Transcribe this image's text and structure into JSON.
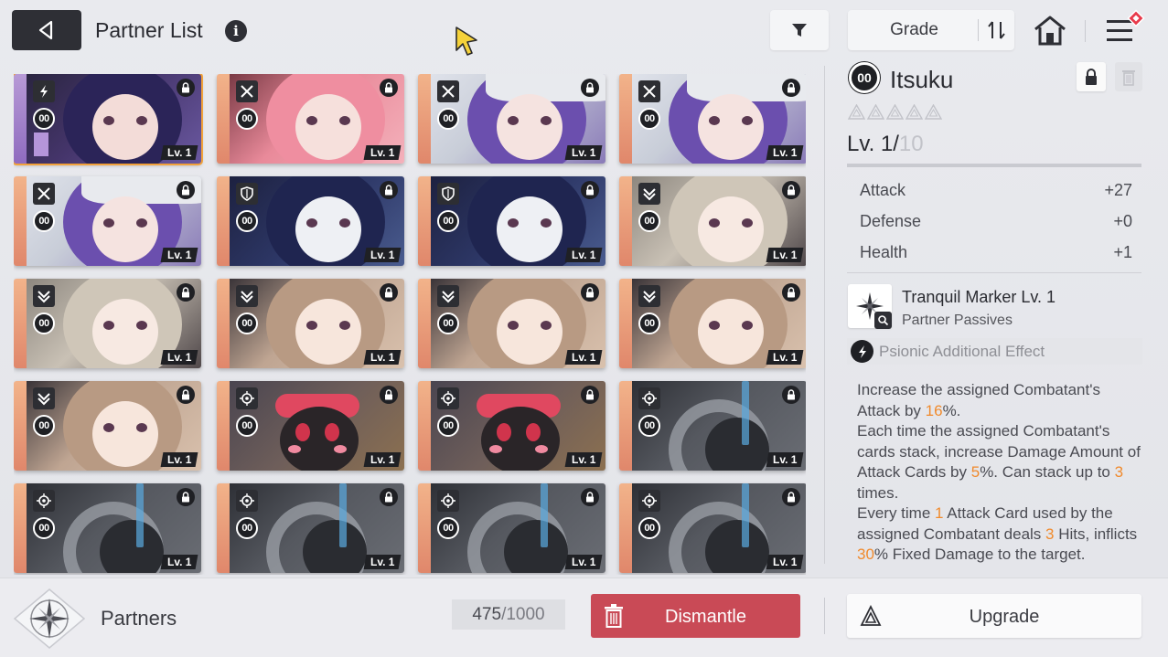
{
  "header": {
    "title": "Partner List",
    "info_icon": "i",
    "sort_label": "Grade",
    "icons": [
      "back-arrow-icon",
      "info-icon",
      "filter-icon",
      "sort-icon",
      "home-icon",
      "menu-icon",
      "notification-diamond-icon"
    ]
  },
  "grid": {
    "cards": [
      {
        "count": "00",
        "level": "Lv. 1",
        "type_icon": "lightning-icon",
        "art": "purple-hair",
        "selected": true
      },
      {
        "count": "00",
        "level": "Lv. 1",
        "type_icon": "crossed-swords-icon",
        "art": "pink-hair"
      },
      {
        "count": "00",
        "level": "Lv. 1",
        "type_icon": "crossed-swords-icon",
        "art": "violet-hat"
      },
      {
        "count": "00",
        "level": "Lv. 1",
        "type_icon": "crossed-swords-icon",
        "art": "violet-hat"
      },
      {
        "count": "00",
        "level": "Lv. 1",
        "type_icon": "crossed-swords-icon",
        "art": "violet-hat"
      },
      {
        "count": "00",
        "level": "Lv. 1",
        "type_icon": "shield-icon",
        "art": "navy-hair"
      },
      {
        "count": "00",
        "level": "Lv. 1",
        "type_icon": "shield-icon",
        "art": "navy-hair"
      },
      {
        "count": "00",
        "level": "Lv. 1",
        "type_icon": "chevron-swords-icon",
        "art": "silver-hair"
      },
      {
        "count": "00",
        "level": "Lv. 1",
        "type_icon": "chevron-swords-icon",
        "art": "silver-hair"
      },
      {
        "count": "00",
        "level": "Lv. 1",
        "type_icon": "chevron-swords-icon",
        "art": "tan-hair"
      },
      {
        "count": "00",
        "level": "Lv. 1",
        "type_icon": "chevron-swords-icon",
        "art": "tan-hair"
      },
      {
        "count": "00",
        "level": "Lv. 1",
        "type_icon": "chevron-swords-icon",
        "art": "tan-hair"
      },
      {
        "count": "00",
        "level": "Lv. 1",
        "type_icon": "chevron-swords-icon",
        "art": "tan-hair"
      },
      {
        "count": "00",
        "level": "Lv. 1",
        "type_icon": "target-icon",
        "art": "creature"
      },
      {
        "count": "00",
        "level": "Lv. 1",
        "type_icon": "target-icon",
        "art": "creature"
      },
      {
        "count": "00",
        "level": "Lv. 1",
        "type_icon": "target-icon",
        "art": "mech"
      },
      {
        "count": "00",
        "level": "Lv. 1",
        "type_icon": "target-icon",
        "art": "mech"
      },
      {
        "count": "00",
        "level": "Lv. 1",
        "type_icon": "target-icon",
        "art": "mech"
      },
      {
        "count": "00",
        "level": "Lv. 1",
        "type_icon": "target-icon",
        "art": "mech"
      },
      {
        "count": "00",
        "level": "Lv. 1",
        "type_icon": "target-icon",
        "art": "mech"
      }
    ]
  },
  "detail": {
    "badge": "00",
    "name": "Itsuku",
    "stars_total": 5,
    "stars_filled": 0,
    "level_current": "Lv. 1/",
    "level_max": "10",
    "stats": [
      {
        "label": "Attack",
        "value": "+27"
      },
      {
        "label": "Defense",
        "value": "+0"
      },
      {
        "label": "Health",
        "value": "+1"
      }
    ],
    "skill": {
      "name": "Tranquil Marker Lv. 1",
      "subtitle": "Partner Passives",
      "icon": "sparkle-star-icon"
    },
    "effect_label": "Psionic Additional Effect",
    "description": {
      "p1a": "Increase the assigned Combatant's Attack by ",
      "p1v": "16",
      "p1b": "%.",
      "p2a": "Each time the assigned Combatant's cards stack, increase Damage Amount of Attack Cards by ",
      "p2v": "5",
      "p2b": "%. Can stack up to ",
      "p2v2": "3",
      "p2c": " times.",
      "p3a": "Every time ",
      "p3v": "1",
      "p3b": " Attack Card used by the assigned Combatant deals ",
      "p3v2": "3",
      "p3c": " Hits, inflicts ",
      "p3v3": "30",
      "p3d": "% Fixed Damage to the target."
    }
  },
  "footer": {
    "partners_label": "Partners",
    "capacity_current": "475",
    "capacity_sep": " / ",
    "capacity_max": "1000",
    "dismantle_label": "Dismantle",
    "upgrade_label": "Upgrade"
  },
  "colors": {
    "accent_orange": "#f08a2c",
    "dismantle_red": "#c94a56",
    "selected_outline": "#f2a23a",
    "dark": "#1f2024"
  }
}
